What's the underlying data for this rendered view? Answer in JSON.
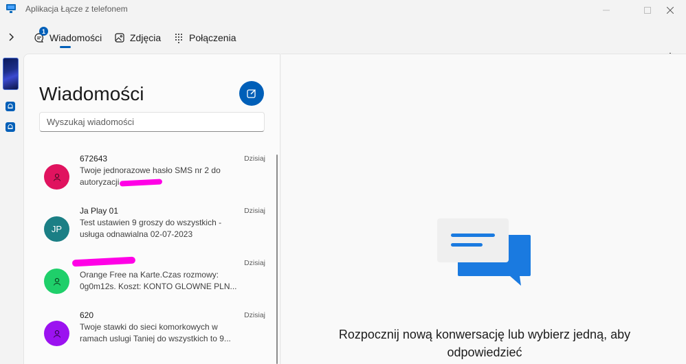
{
  "window": {
    "title": "Aplikacja Łącze z telefonem"
  },
  "nav": {
    "tabs": [
      {
        "label": "Wiadomości",
        "icon": "chat-icon",
        "badge": "1",
        "active": true
      },
      {
        "label": "Zdjęcia",
        "icon": "photos-icon"
      },
      {
        "label": "Połączenia",
        "icon": "dialpad-icon"
      }
    ]
  },
  "messages": {
    "title": "Wiadomości",
    "search_placeholder": "Wyszukaj wiadomości",
    "conversations": [
      {
        "name": "672643",
        "date": "Dzisiaj",
        "preview": "Twoje jednorazowe hasło SMS nr 2 do autoryzacji",
        "avatar_color": "#e0135f",
        "initials": ""
      },
      {
        "name": "Ja Play 01",
        "date": "Dzisiaj",
        "preview": "Test ustawien 9 groszy do wszystkich - usługa odnawialna 02-07-2023",
        "avatar_color": "#1b7f85",
        "initials": "JP"
      },
      {
        "name": "",
        "date": "Dzisiaj",
        "preview": "Orange Free na Karte.Czas rozmowy: 0g0m12s. Koszt: KONTO GLOWNE PLN...",
        "avatar_color": "#1fcf6a",
        "initials": ""
      },
      {
        "name": "620",
        "date": "Dzisiaj",
        "preview": "Twoje stawki do sieci komorkowych w ramach uslugi Taniej do wszystkich to 9...",
        "avatar_color": "#9b12f0",
        "initials": ""
      }
    ]
  },
  "detail": {
    "empty_message": "Rozpocznij nową konwersację lub wybierz jedną, aby odpowiedzieć"
  },
  "colors": {
    "accent": "#005fb8",
    "redaction": "#ff00e6"
  }
}
